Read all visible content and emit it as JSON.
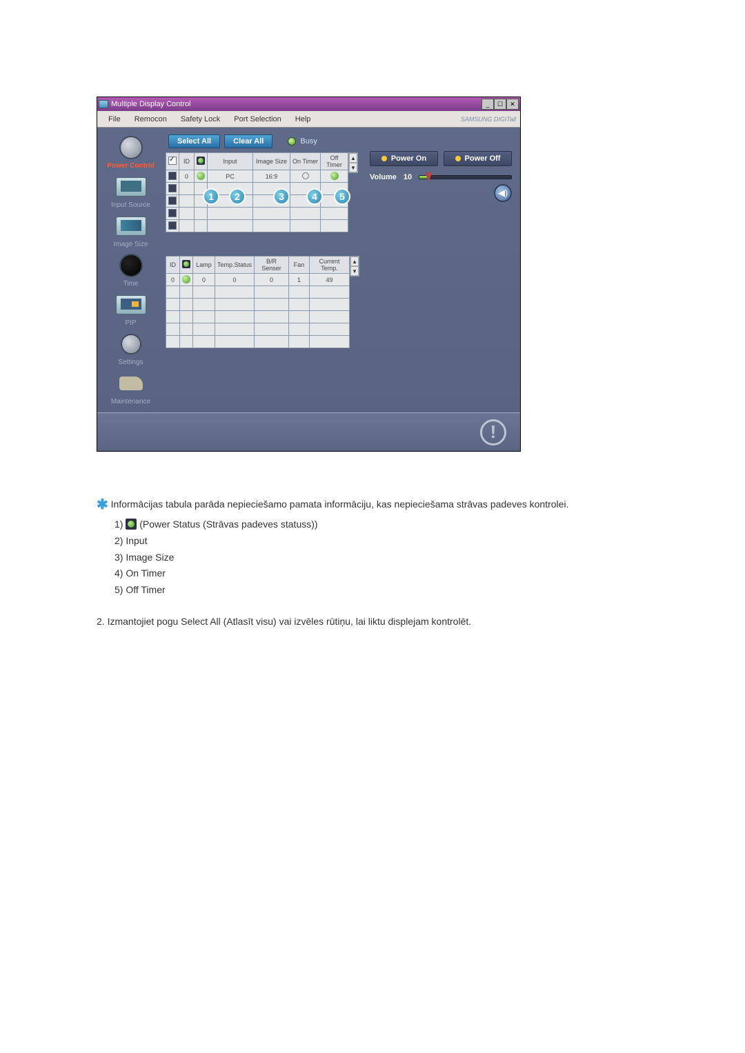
{
  "window": {
    "title": "Multiple Display Control",
    "brand": "SAMSUNG DIGITall"
  },
  "menu": {
    "file": "File",
    "remocon": "Remocon",
    "safety": "Safety Lock",
    "port": "Port Selection",
    "help": "Help"
  },
  "sidebar": {
    "items": [
      {
        "label": "Power Control",
        "active": true
      },
      {
        "label": "Input Source"
      },
      {
        "label": "Image Size"
      },
      {
        "label": "Time"
      },
      {
        "label": "PIP"
      },
      {
        "label": "Settings"
      },
      {
        "label": "Maintenance"
      }
    ]
  },
  "toolbar": {
    "select_all": "Select All",
    "clear_all": "Clear All",
    "busy": "Busy"
  },
  "table1": {
    "headers": {
      "chk": "",
      "id": "ID",
      "pw": "",
      "input": "Input",
      "imgsize": "Image Size",
      "ontimer": "On Timer",
      "offtimer": "Off Timer"
    },
    "rows": [
      {
        "checked": "filled",
        "id": "0",
        "pw": "green",
        "input": "PC",
        "imgsize": "16:9",
        "on": "off",
        "off": "green"
      },
      {
        "checked": "filled",
        "id": "",
        "pw": "",
        "input": "",
        "imgsize": "",
        "on": "",
        "off": ""
      },
      {
        "checked": "filled",
        "id": "",
        "pw": "",
        "input": "",
        "imgsize": "",
        "on": "",
        "off": ""
      },
      {
        "checked": "filled",
        "id": "",
        "pw": "",
        "input": "",
        "imgsize": "",
        "on": "",
        "off": ""
      },
      {
        "checked": "filled",
        "id": "",
        "pw": "",
        "input": "",
        "imgsize": "",
        "on": "",
        "off": ""
      }
    ]
  },
  "table2": {
    "headers": {
      "id": "ID",
      "pw": "",
      "lamp": "Lamp",
      "tempstatus": "Temp.Status",
      "brsenser": "B/R Senser",
      "fan": "Fan",
      "curtemp": "Current Temp."
    },
    "rows": [
      {
        "id": "0",
        "pw": "green",
        "lamp": "0",
        "tempstatus": "0",
        "brsenser": "0",
        "fan": "1",
        "curtemp": "49"
      },
      {
        "id": "",
        "pw": "",
        "lamp": "",
        "tempstatus": "",
        "brsenser": "",
        "fan": "",
        "curtemp": ""
      },
      {
        "id": "",
        "pw": "",
        "lamp": "",
        "tempstatus": "",
        "brsenser": "",
        "fan": "",
        "curtemp": ""
      },
      {
        "id": "",
        "pw": "",
        "lamp": "",
        "tempstatus": "",
        "brsenser": "",
        "fan": "",
        "curtemp": ""
      },
      {
        "id": "",
        "pw": "",
        "lamp": "",
        "tempstatus": "",
        "brsenser": "",
        "fan": "",
        "curtemp": ""
      },
      {
        "id": "",
        "pw": "",
        "lamp": "",
        "tempstatus": "",
        "brsenser": "",
        "fan": "",
        "curtemp": ""
      }
    ]
  },
  "panel": {
    "power_on": "Power On",
    "power_off": "Power Off",
    "volume_label": "Volume",
    "volume_value": "10"
  },
  "badges": [
    "1",
    "2",
    "3",
    "4",
    "5"
  ],
  "descr": {
    "line0": "Informācijas tabula parāda nepieciešamo pamata informāciju, kas nepieciešama strāvas padeves kontrolei.",
    "li1": "1) ",
    "li1b": " (Power Status (Strāvas padeves statuss))",
    "li2": "2) Input",
    "li3": "3) Image Size",
    "li4": "4) On Timer",
    "li5": "5) Off Timer",
    "line2": "2.  Izmantojiet pogu Select All (Atlasīt visu) vai izvēles rūtiņu, lai liktu displejam kontrolēt."
  }
}
